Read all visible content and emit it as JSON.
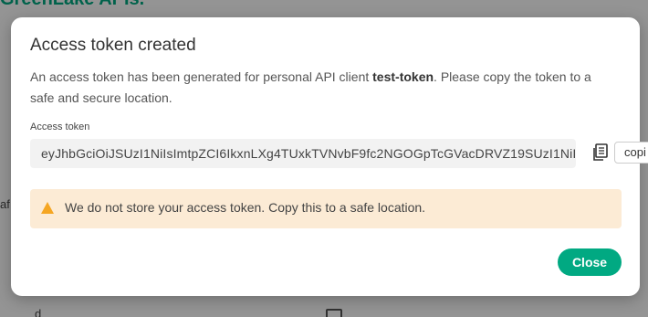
{
  "background": {
    "heading": "GreenLake APIs.",
    "side_text": "af",
    "bottom_text": "d"
  },
  "modal": {
    "title": "Access token created",
    "description_before": "An access token has been generated for personal API client ",
    "client_name": "test-token",
    "description_after": ". Please copy the token to a safe and secure location.",
    "field_label": "Access token",
    "token_value": "eyJhbGciOiJSUzI1NiIsImtpZCI6IkxnLXg4TUxkTVNvbF9fc2NGOGpTcGVacDRVZ19SUzI1NiI",
    "copy_button_label": "copi",
    "warning_text": "We do not store your access token. Copy this to a safe location.",
    "close_button_label": "Close"
  },
  "icons": {
    "copy": "copy-icon",
    "warning": "warning-icon"
  },
  "colors": {
    "brand": "#01a982",
    "warning_bg": "#fcebd5",
    "warning_icon": "#f5a623"
  }
}
